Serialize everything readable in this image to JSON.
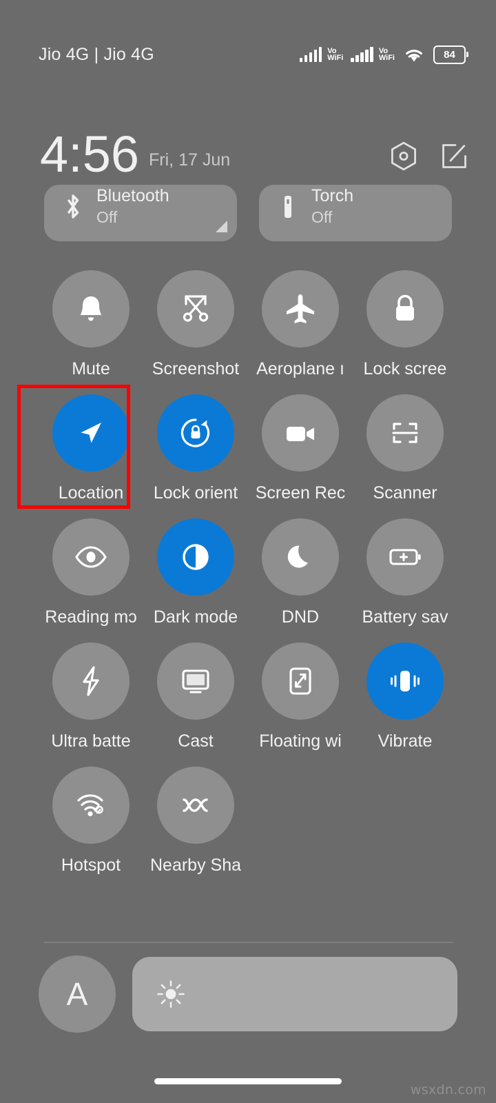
{
  "status_bar": {
    "carrier": "Jio 4G | Jio 4G",
    "sim1_network_label": "Vo\nWiFi",
    "sim1_network_top": "Vo",
    "sim1_network_bottom": "WiFi",
    "sim2_network_top": "Vo",
    "sim2_network_bottom": "WiFi",
    "battery_percent": "84"
  },
  "header": {
    "clock": "4:56",
    "date": "Fri, 17 Jun",
    "settings_icon": "hexagon-gear-icon",
    "edit_icon": "edit-pencil-icon"
  },
  "cards": [
    {
      "title": "Bluetooth",
      "status": "Off",
      "icon": "bluetooth-icon",
      "active": false,
      "has_expand_corner": true
    },
    {
      "title": "Torch",
      "status": "Off",
      "icon": "torch-icon",
      "active": false,
      "has_expand_corner": false
    }
  ],
  "toggles": [
    {
      "label": "Mute",
      "icon": "bell-icon",
      "active": false,
      "highlighted": false
    },
    {
      "label": "Screenshot",
      "icon": "scissors-icon",
      "active": false,
      "highlighted": false
    },
    {
      "label": "Aeroplane ı",
      "icon": "airplane-icon",
      "active": false,
      "highlighted": false
    },
    {
      "label": "Lock scree",
      "icon": "lock-icon",
      "active": false,
      "highlighted": false
    },
    {
      "label": "Location",
      "icon": "location-arrow-icon",
      "active": true,
      "highlighted": true
    },
    {
      "label": "Lock orient",
      "icon": "rotation-lock-icon",
      "active": true,
      "highlighted": false
    },
    {
      "label": "Screen Rec",
      "icon": "video-camera-icon",
      "active": false,
      "highlighted": false
    },
    {
      "label": "Scanner",
      "icon": "scan-frame-icon",
      "active": false,
      "highlighted": false
    },
    {
      "label": "Reading mɔ",
      "icon": "eye-icon",
      "active": false,
      "highlighted": false
    },
    {
      "label": "Dark mode",
      "icon": "contrast-circle-icon",
      "active": true,
      "highlighted": false
    },
    {
      "label": "DND",
      "icon": "moon-icon",
      "active": false,
      "highlighted": false
    },
    {
      "label": "Battery sav",
      "icon": "battery-plus-icon",
      "active": false,
      "highlighted": false
    },
    {
      "label": "Ultra batte",
      "icon": "lightning-bolt-icon",
      "active": false,
      "highlighted": false
    },
    {
      "label": "Cast",
      "icon": "monitor-icon",
      "active": false,
      "highlighted": false
    },
    {
      "label": "Floating wi",
      "icon": "floating-window-icon",
      "active": false,
      "highlighted": false
    },
    {
      "label": "Vibrate",
      "icon": "vibrate-icon",
      "active": true,
      "highlighted": false
    },
    {
      "label": "Hotspot",
      "icon": "hotspot-icon",
      "active": false,
      "highlighted": false
    },
    {
      "label": "Nearby Sha",
      "icon": "nearby-share-icon",
      "active": false,
      "highlighted": false
    }
  ],
  "brightness": {
    "auto_label": "A",
    "slider_icon": "sun-brightness-icon"
  },
  "colors": {
    "background": "#6b6b6b",
    "tile_inactive": "#8f8f8f",
    "tile_active": "#0b7ad6",
    "card": "#8d8d8d",
    "slider_track": "#a9a9a9",
    "highlight": "#ff0000",
    "text_primary": "#f2f2f2",
    "text_secondary": "#c9c9c9"
  },
  "watermark": "wsxdn.com"
}
